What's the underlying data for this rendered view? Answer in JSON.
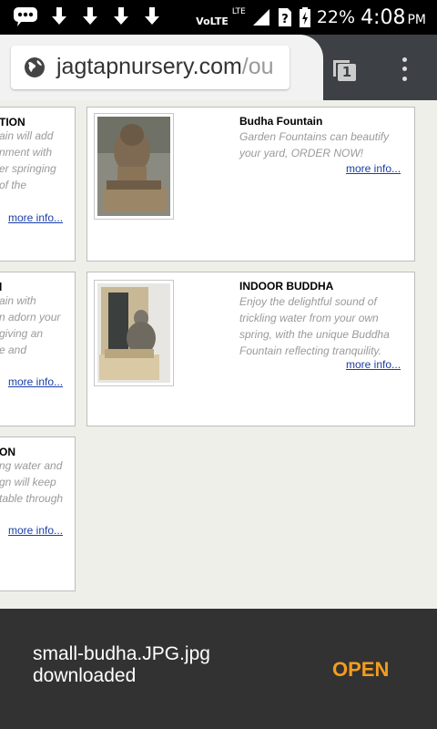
{
  "status_bar": {
    "time": "4:08",
    "ampm": "PM",
    "battery": "22%",
    "network_label": "VoLTE",
    "network_type": "LTE"
  },
  "browser": {
    "url_host": "jagtapnursery.com",
    "url_rest": "/ou",
    "tab_count": "1"
  },
  "cards_left": [
    {
      "title": "TION",
      "desc": [
        "ain will add",
        "nment with",
        "er springing",
        "of the"
      ],
      "more": "more info..."
    },
    {
      "title": "l",
      "desc": [
        "ain with",
        "n adorn your",
        "giving an",
        "e and"
      ],
      "more": "more info..."
    },
    {
      "title": "ON",
      "desc": [
        "ng water and",
        "gn will keep",
        "table through"
      ],
      "more": "more info..."
    }
  ],
  "cards_right": [
    {
      "title": "Budha Fountain",
      "desc": [
        "Garden Fountains can beautify",
        "your yard, ORDER NOW!"
      ],
      "more": "more info..."
    },
    {
      "title": "INDOOR BUDDHA",
      "desc": [
        "Enjoy the delightful sound of",
        "trickling water from your own",
        "spring, with the unique Buddha",
        "Fountain reflecting tranquility."
      ],
      "more": "more info..."
    }
  ],
  "snackbar": {
    "line1": "small-budha.JPG.jpg",
    "line2": "downloaded",
    "action": "OPEN"
  },
  "colors": {
    "accent": "#f39c1d",
    "link": "#1a3ea6",
    "toolbar": "#3d4044"
  }
}
